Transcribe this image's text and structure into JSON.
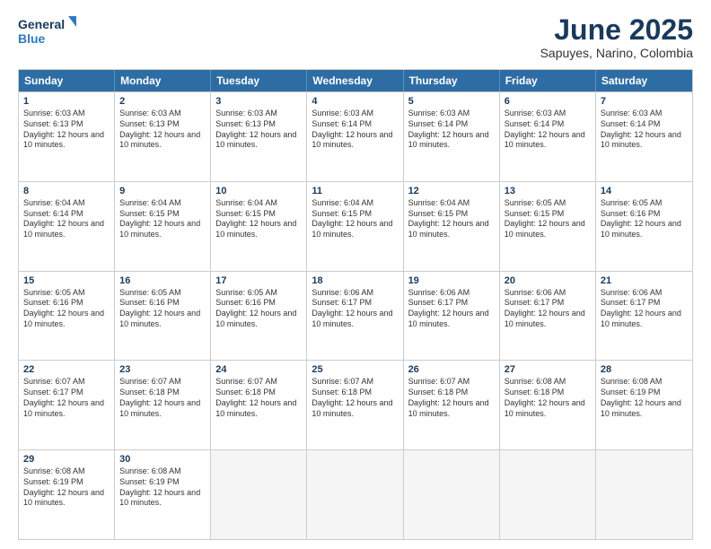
{
  "header": {
    "logo_line1": "General",
    "logo_line2": "Blue",
    "month": "June 2025",
    "location": "Sapuyes, Narino, Colombia"
  },
  "days_of_week": [
    "Sunday",
    "Monday",
    "Tuesday",
    "Wednesday",
    "Thursday",
    "Friday",
    "Saturday"
  ],
  "weeks": [
    [
      {
        "day": 1,
        "sunrise": "6:03 AM",
        "sunset": "6:13 PM",
        "daylight": "12 hours and 10 minutes."
      },
      {
        "day": 2,
        "sunrise": "6:03 AM",
        "sunset": "6:13 PM",
        "daylight": "12 hours and 10 minutes."
      },
      {
        "day": 3,
        "sunrise": "6:03 AM",
        "sunset": "6:13 PM",
        "daylight": "12 hours and 10 minutes."
      },
      {
        "day": 4,
        "sunrise": "6:03 AM",
        "sunset": "6:14 PM",
        "daylight": "12 hours and 10 minutes."
      },
      {
        "day": 5,
        "sunrise": "6:03 AM",
        "sunset": "6:14 PM",
        "daylight": "12 hours and 10 minutes."
      },
      {
        "day": 6,
        "sunrise": "6:03 AM",
        "sunset": "6:14 PM",
        "daylight": "12 hours and 10 minutes."
      },
      {
        "day": 7,
        "sunrise": "6:03 AM",
        "sunset": "6:14 PM",
        "daylight": "12 hours and 10 minutes."
      }
    ],
    [
      {
        "day": 8,
        "sunrise": "6:04 AM",
        "sunset": "6:14 PM",
        "daylight": "12 hours and 10 minutes."
      },
      {
        "day": 9,
        "sunrise": "6:04 AM",
        "sunset": "6:15 PM",
        "daylight": "12 hours and 10 minutes."
      },
      {
        "day": 10,
        "sunrise": "6:04 AM",
        "sunset": "6:15 PM",
        "daylight": "12 hours and 10 minutes."
      },
      {
        "day": 11,
        "sunrise": "6:04 AM",
        "sunset": "6:15 PM",
        "daylight": "12 hours and 10 minutes."
      },
      {
        "day": 12,
        "sunrise": "6:04 AM",
        "sunset": "6:15 PM",
        "daylight": "12 hours and 10 minutes."
      },
      {
        "day": 13,
        "sunrise": "6:05 AM",
        "sunset": "6:15 PM",
        "daylight": "12 hours and 10 minutes."
      },
      {
        "day": 14,
        "sunrise": "6:05 AM",
        "sunset": "6:16 PM",
        "daylight": "12 hours and 10 minutes."
      }
    ],
    [
      {
        "day": 15,
        "sunrise": "6:05 AM",
        "sunset": "6:16 PM",
        "daylight": "12 hours and 10 minutes."
      },
      {
        "day": 16,
        "sunrise": "6:05 AM",
        "sunset": "6:16 PM",
        "daylight": "12 hours and 10 minutes."
      },
      {
        "day": 17,
        "sunrise": "6:05 AM",
        "sunset": "6:16 PM",
        "daylight": "12 hours and 10 minutes."
      },
      {
        "day": 18,
        "sunrise": "6:06 AM",
        "sunset": "6:17 PM",
        "daylight": "12 hours and 10 minutes."
      },
      {
        "day": 19,
        "sunrise": "6:06 AM",
        "sunset": "6:17 PM",
        "daylight": "12 hours and 10 minutes."
      },
      {
        "day": 20,
        "sunrise": "6:06 AM",
        "sunset": "6:17 PM",
        "daylight": "12 hours and 10 minutes."
      },
      {
        "day": 21,
        "sunrise": "6:06 AM",
        "sunset": "6:17 PM",
        "daylight": "12 hours and 10 minutes."
      }
    ],
    [
      {
        "day": 22,
        "sunrise": "6:07 AM",
        "sunset": "6:17 PM",
        "daylight": "12 hours and 10 minutes."
      },
      {
        "day": 23,
        "sunrise": "6:07 AM",
        "sunset": "6:18 PM",
        "daylight": "12 hours and 10 minutes."
      },
      {
        "day": 24,
        "sunrise": "6:07 AM",
        "sunset": "6:18 PM",
        "daylight": "12 hours and 10 minutes."
      },
      {
        "day": 25,
        "sunrise": "6:07 AM",
        "sunset": "6:18 PM",
        "daylight": "12 hours and 10 minutes."
      },
      {
        "day": 26,
        "sunrise": "6:07 AM",
        "sunset": "6:18 PM",
        "daylight": "12 hours and 10 minutes."
      },
      {
        "day": 27,
        "sunrise": "6:08 AM",
        "sunset": "6:18 PM",
        "daylight": "12 hours and 10 minutes."
      },
      {
        "day": 28,
        "sunrise": "6:08 AM",
        "sunset": "6:19 PM",
        "daylight": "12 hours and 10 minutes."
      }
    ],
    [
      {
        "day": 29,
        "sunrise": "6:08 AM",
        "sunset": "6:19 PM",
        "daylight": "12 hours and 10 minutes."
      },
      {
        "day": 30,
        "sunrise": "6:08 AM",
        "sunset": "6:19 PM",
        "daylight": "12 hours and 10 minutes."
      },
      null,
      null,
      null,
      null,
      null
    ]
  ]
}
